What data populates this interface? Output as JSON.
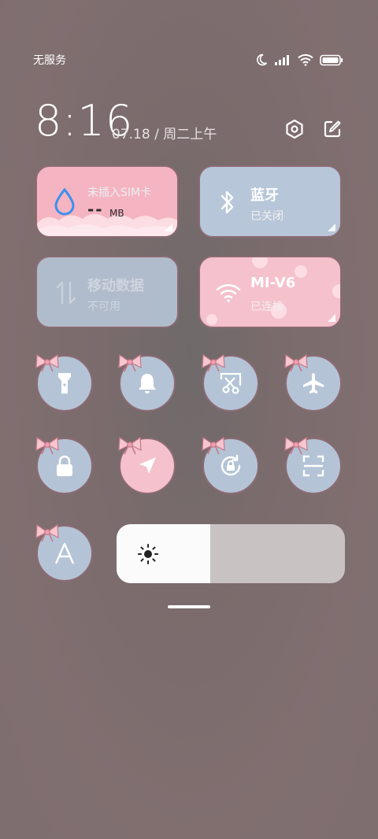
{
  "status_bar": {
    "carrier": "无服务",
    "icons": [
      "moon-icon",
      "signal-icon",
      "wifi-icon",
      "battery-icon"
    ]
  },
  "header": {
    "time": "8:16",
    "date": "07.18 / 周二上午",
    "icons": [
      "settings-icon",
      "edit-icon"
    ]
  },
  "tiles": {
    "sim": {
      "title": "未插入SIM卡",
      "value": "--",
      "unit": "MB",
      "icon": "water-drop-icon"
    },
    "bluetooth": {
      "title": "蓝牙",
      "status": "已关闭",
      "icon": "bluetooth-icon"
    },
    "mobile_data": {
      "title": "移动数据",
      "status": "不可用",
      "icon": "data-arrows-icon"
    },
    "wifi": {
      "title": "MI-V6",
      "status": "已连接",
      "icon": "wifi-icon"
    }
  },
  "toggles": [
    {
      "name": "flashlight",
      "icon": "flashlight-icon",
      "active": false
    },
    {
      "name": "ringer",
      "icon": "bell-icon",
      "active": false
    },
    {
      "name": "screenshot",
      "icon": "scissors-icon",
      "active": false
    },
    {
      "name": "airplane",
      "icon": "airplane-icon",
      "active": false
    },
    {
      "name": "lock-screen",
      "icon": "lock-icon",
      "active": false
    },
    {
      "name": "location",
      "icon": "navigation-icon",
      "active": true
    },
    {
      "name": "rotation-lock",
      "icon": "rotation-lock-icon",
      "active": false
    },
    {
      "name": "scanner",
      "icon": "scan-icon",
      "active": false
    },
    {
      "name": "auto-brightness",
      "icon": "letter-a-icon",
      "active": false
    }
  ],
  "brightness": {
    "level": 0.41,
    "icon": "sun-icon"
  },
  "colors": {
    "tile_blue": "#b7c6d8",
    "tile_pink": "#f5b4c1",
    "accent_drop": "#3b8ff0"
  }
}
